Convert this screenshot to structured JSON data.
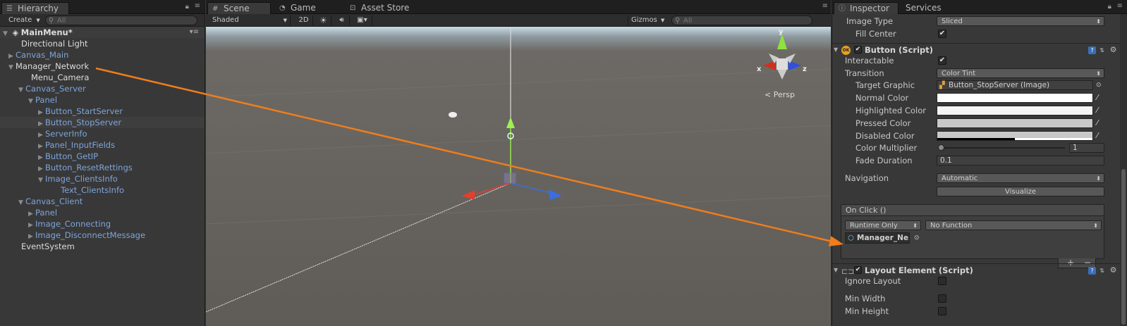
{
  "hierarchy": {
    "tab": "Hierarchy",
    "create": "Create",
    "search_placeholder": "All",
    "scene": "MainMenu*",
    "items": [
      {
        "label": "Directional Light",
        "arrow": ""
      },
      {
        "label": "Canvas_Main",
        "arrow": "▶"
      },
      {
        "label": "Manager_Network",
        "arrow": "▼"
      },
      {
        "label": "Menu_Camera",
        "arrow": ""
      },
      {
        "label": "Canvas_Server",
        "arrow": "▼"
      },
      {
        "label": "Panel",
        "arrow": "▼"
      },
      {
        "label": "Button_StartServer",
        "arrow": "▶"
      },
      {
        "label": "Button_StopServer",
        "arrow": "▶"
      },
      {
        "label": "ServerInfo",
        "arrow": "▶"
      },
      {
        "label": "Panel_InputFields",
        "arrow": "▶"
      },
      {
        "label": "Button_GetIP",
        "arrow": "▶"
      },
      {
        "label": "Button_ResetRettings",
        "arrow": "▶"
      },
      {
        "label": "Image_ClientsInfo",
        "arrow": "▼"
      },
      {
        "label": "Text_ClientsInfo",
        "arrow": ""
      },
      {
        "label": "Canvas_Client",
        "arrow": "▼"
      },
      {
        "label": "Panel",
        "arrow": "▶"
      },
      {
        "label": "Image_Connecting",
        "arrow": "▶"
      },
      {
        "label": "Image_DisconnectMessage",
        "arrow": "▶"
      },
      {
        "label": "EventSystem",
        "arrow": ""
      }
    ]
  },
  "scene_view": {
    "tabs": [
      "Scene",
      "Game",
      "Asset Store"
    ],
    "shading": "Shaded",
    "mode_2d": "2D",
    "gizmos": "Gizmos",
    "search_placeholder": "All",
    "persp": "Persp",
    "axis_x": "x",
    "axis_y": "y",
    "axis_z": "z"
  },
  "inspector": {
    "tabs": [
      "Inspector",
      "Services"
    ],
    "image_type_label": "Image Type",
    "image_type_value": "Sliced",
    "fill_center_label": "Fill Center",
    "button_component": "Button (Script)",
    "interactable_label": "Interactable",
    "transition_label": "Transition",
    "transition_value": "Color Tint",
    "target_graphic_label": "Target Graphic",
    "target_graphic_value": "Button_StopServer (Image)",
    "normal_color_label": "Normal Color",
    "highlighted_color_label": "Highlighted Color",
    "pressed_color_label": "Pressed Color",
    "disabled_color_label": "Disabled Color",
    "color_multiplier_label": "Color Multiplier",
    "color_multiplier_value": "1",
    "fade_duration_label": "Fade Duration",
    "fade_duration_value": "0.1",
    "navigation_label": "Navigation",
    "navigation_value": "Automatic",
    "visualize_label": "Visualize",
    "onclick_header": "On Click ()",
    "runtime_value": "Runtime Only",
    "function_value": "No Function",
    "object_value": "Manager_Ne",
    "plus": "+",
    "minus": "−",
    "layout_component": "Layout Element (Script)",
    "ignore_layout_label": "Ignore Layout",
    "min_width_label": "Min Width",
    "min_height_label": "Min Height"
  },
  "colors": {
    "normal": "#ffffff",
    "highlighted": "#f5f5f5",
    "pressed": "#c8c8c8",
    "disabled": "#c8c8c8",
    "annotation_arrow": "#f07d1a"
  }
}
